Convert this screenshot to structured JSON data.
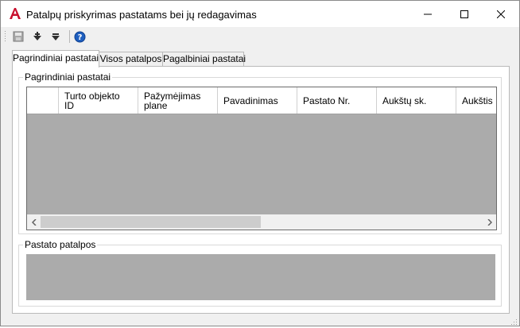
{
  "window": {
    "title": "Patalpų priskyrimas pastatams bei jų redagavimas",
    "app_icon": "autocad-a-icon",
    "controls": [
      "minimize-icon",
      "maximize-icon",
      "close-icon"
    ]
  },
  "toolbar": {
    "items": [
      "save-icon",
      "add-row-icon",
      "remove-row-icon",
      "help-icon"
    ]
  },
  "tabs": [
    {
      "label": "Pagrindiniai pastatai",
      "active": true
    },
    {
      "label": "Visos patalpos",
      "active": false
    },
    {
      "label": "Pagalbiniai pastatai",
      "active": false
    }
  ],
  "main_group": {
    "legend": "Pagrindiniai pastatai",
    "columns": [
      "",
      "Turto objekto\nID",
      "Pažymėjimas\nplane",
      "Pavadinimas",
      "Pastato Nr.",
      "Aukštų sk.",
      "Aukštis"
    ],
    "rows": []
  },
  "detail_group": {
    "legend": "Pastato patalpos"
  },
  "colors": {
    "accent": "#c8102e",
    "help": "#1f5fbf",
    "grid_empty": "#ababab"
  }
}
